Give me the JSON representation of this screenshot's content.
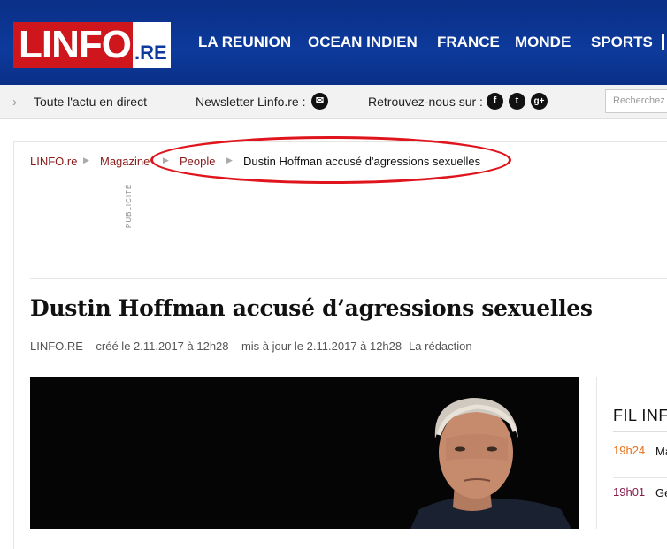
{
  "header": {
    "logo_main": "LINFO",
    "logo_suffix": ".RE",
    "nav": [
      "LA REUNION",
      "OCEAN INDIEN",
      "FRANCE",
      "MONDE",
      "SPORTS"
    ]
  },
  "subbar": {
    "live": "Toute l'actu en direct",
    "newsletter": "Newsletter Linfo.re :",
    "follow": "Retrouvez-nous sur :",
    "social_icons": [
      "facebook-icon",
      "twitter-icon",
      "google-plus-icon"
    ],
    "search_placeholder": "Recherchez"
  },
  "breadcrumb": [
    "LINFO.re",
    "Magazine",
    "People",
    "Dustin Hoffman accusé d'agressions sexuelles"
  ],
  "publicite": "PUBLICITÉ",
  "article": {
    "title": "Dustin Hoffman accusé d’agressions sexuelles",
    "meta": "LINFO.RE – créé le 2.11.2017 à 12h28 – mis à jour le 2.11.2017 à 12h28- La rédaction"
  },
  "fil_info": {
    "title": "FIL INFO",
    "items": [
      {
        "time": "19h24",
        "time_color": "#e8701a",
        "text": "Ma so"
      },
      {
        "time": "19h01",
        "time_color": "#8a1b4a",
        "text": "Ge no"
      }
    ]
  },
  "colors": {
    "header_bg": "#0d3a9c",
    "logo_red": "#d0161d",
    "annotation_red": "#e0141c",
    "breadcrumb_link": "#8a1b1b"
  }
}
